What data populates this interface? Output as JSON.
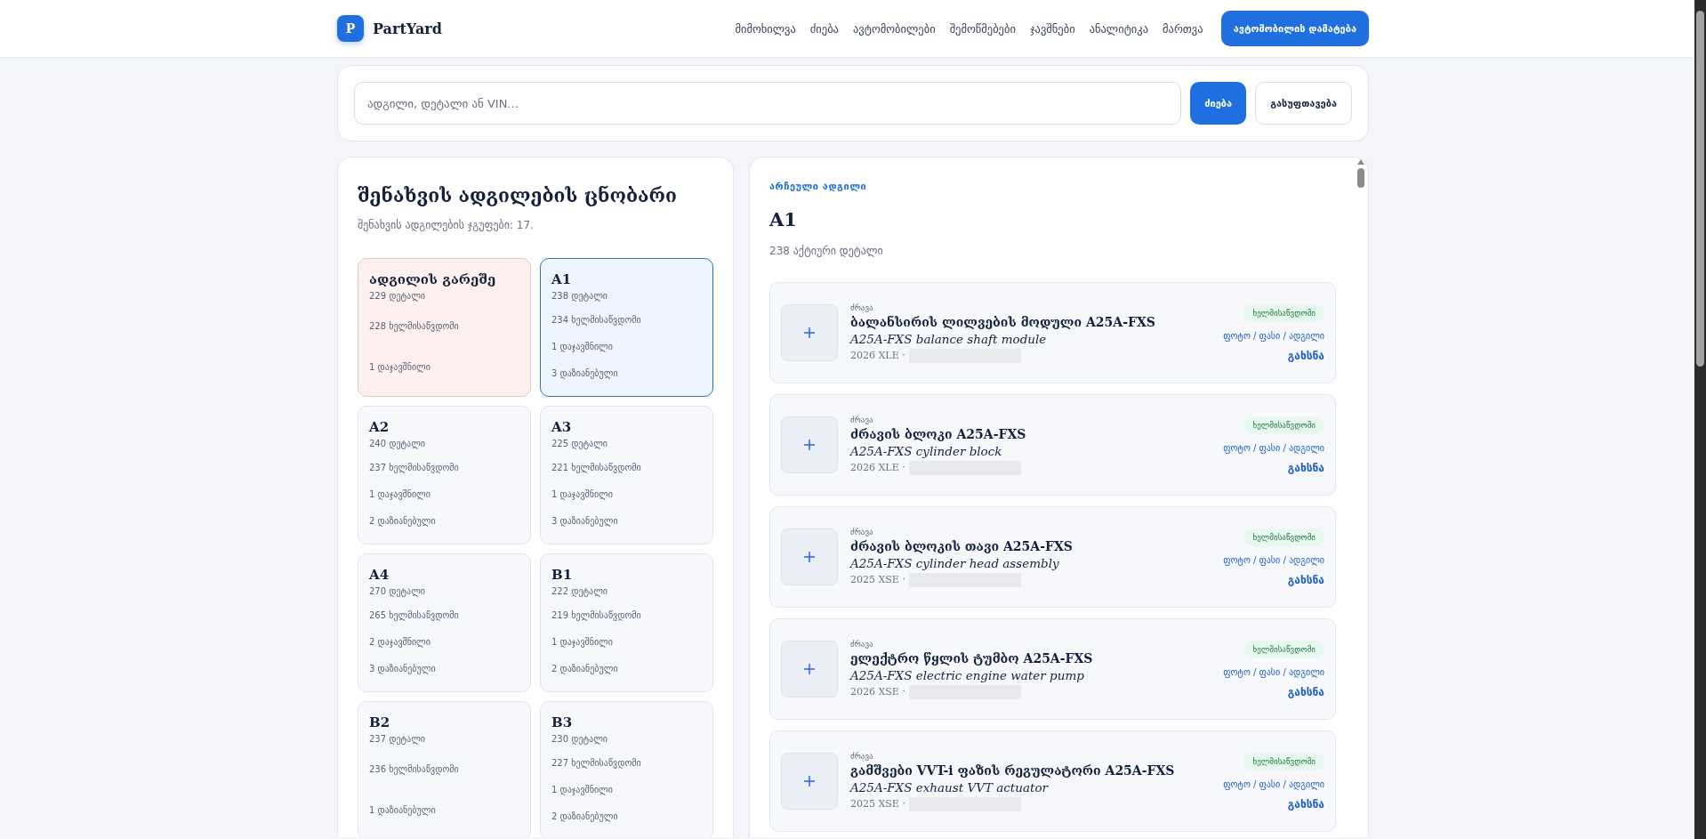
{
  "header": {
    "logo_letter": "P",
    "brand": "PartYard",
    "nav": [
      {
        "label": "მიმოხილვა",
        "selected": false
      },
      {
        "label": "ძიება",
        "selected": false
      },
      {
        "label": "ავტომობილები",
        "selected": false
      },
      {
        "label": "შემოწმებები",
        "selected": false
      },
      {
        "label": "ჯავშნები",
        "selected": false
      },
      {
        "label": "ანალიტიკა",
        "selected": false
      },
      {
        "label": "მართვა",
        "selected": false
      }
    ],
    "action": "ავტომობილის დამატება"
  },
  "search": {
    "placeholder": "ადგილი, დეტალი ან VIN...",
    "submit": "ძიება",
    "clear": "გასუფთავება"
  },
  "directory": {
    "title": "შენახვის ადგილების ცნობარი",
    "subtitle": "შენახვის ადგილების ჯგუფები: 17.",
    "locations": [
      {
        "kind": "unassigned",
        "selected": false,
        "name": "ადგილის გარეშე",
        "parts": "229 დეტალი",
        "stats": [
          "228 ხელმისაწვდომი",
          "1 დაჯავშნილი"
        ]
      },
      {
        "kind": "slot",
        "selected": true,
        "name": "A1",
        "parts": "238 დეტალი",
        "stats": [
          "234 ხელმისაწვდომი",
          "1 დაჯავშნილი",
          "3 დაზიანებული"
        ]
      },
      {
        "kind": "slot",
        "selected": false,
        "name": "A2",
        "parts": "240 დეტალი",
        "stats": [
          "237 ხელმისაწვდომი",
          "1 დაჯავშნილი",
          "2 დაზიანებული"
        ]
      },
      {
        "kind": "slot",
        "selected": false,
        "name": "A3",
        "parts": "225 დეტალი",
        "stats": [
          "221 ხელმისაწვდომი",
          "1 დაჯავშნილი",
          "3 დაზიანებული"
        ]
      },
      {
        "kind": "slot",
        "selected": false,
        "name": "A4",
        "parts": "270 დეტალი",
        "stats": [
          "265 ხელმისაწვდომი",
          "2 დაჯავშნილი",
          "3 დაზიანებული"
        ]
      },
      {
        "kind": "slot",
        "selected": false,
        "name": "B1",
        "parts": "222 დეტალი",
        "stats": [
          "219 ხელმისაწვდომი",
          "1 დაჯავშნილი",
          "2 დაზიანებული"
        ]
      },
      {
        "kind": "slot",
        "selected": false,
        "name": "B2",
        "parts": "237 დეტალი",
        "stats": [
          "236 ხელმისაწვდომი",
          "1 დაზიანებული"
        ]
      },
      {
        "kind": "slot",
        "selected": false,
        "name": "B3",
        "parts": "230 დეტალი",
        "stats": [
          "227 ხელმისაწვდომი",
          "1 დაჯავშნილი",
          "2 დაზიანებული"
        ]
      }
    ]
  },
  "detail": {
    "eyebrow": "არჩეული ადგილი",
    "title": "A1",
    "count": "238 აქტიური დეტალი",
    "parts": [
      {
        "category": "ძრავა",
        "title": "ბალანსირის ლილვების მოდული A25A-FXS",
        "subtitle": "A25A-FXS balance shaft module",
        "meta": "2026 XLE ·",
        "status": "ხელმისაწვდომი",
        "links": "ფოტო / ფასი / ადგილი",
        "open": "გახსნა"
      },
      {
        "category": "ძრავა",
        "title": "ძრავის ბლოკი A25A-FXS",
        "subtitle": "A25A-FXS cylinder block",
        "meta": "2026 XLE ·",
        "status": "ხელმისაწვდომი",
        "links": "ფოტო / ფასი / ადგილი",
        "open": "გახსნა"
      },
      {
        "category": "ძრავა",
        "title": "ძრავის ბლოკის თავი A25A-FXS",
        "subtitle": "A25A-FXS cylinder head assembly",
        "meta": "2025 XSE ·",
        "status": "ხელმისაწვდომი",
        "links": "ფოტო / ფასი / ადგილი",
        "open": "გახსნა"
      },
      {
        "category": "ძრავა",
        "title": "ელექტრო წყლის ტუმბო A25A-FXS",
        "subtitle": "A25A-FXS electric engine water pump",
        "meta": "2026 XSE ·",
        "status": "ხელმისაწვდომი",
        "links": "ფოტო / ფასი / ადგილი",
        "open": "გახსნა"
      },
      {
        "category": "ძრავა",
        "title": "გამშვები VVT-i ფაზის რეგულატორი A25A-FXS",
        "subtitle": "A25A-FXS exhaust VVT actuator",
        "meta": "2025 XSE ·",
        "status": "ხელმისაწვდომი",
        "links": "ფოტო / ფასი / ადგილი",
        "open": "გახსნა"
      }
    ]
  }
}
